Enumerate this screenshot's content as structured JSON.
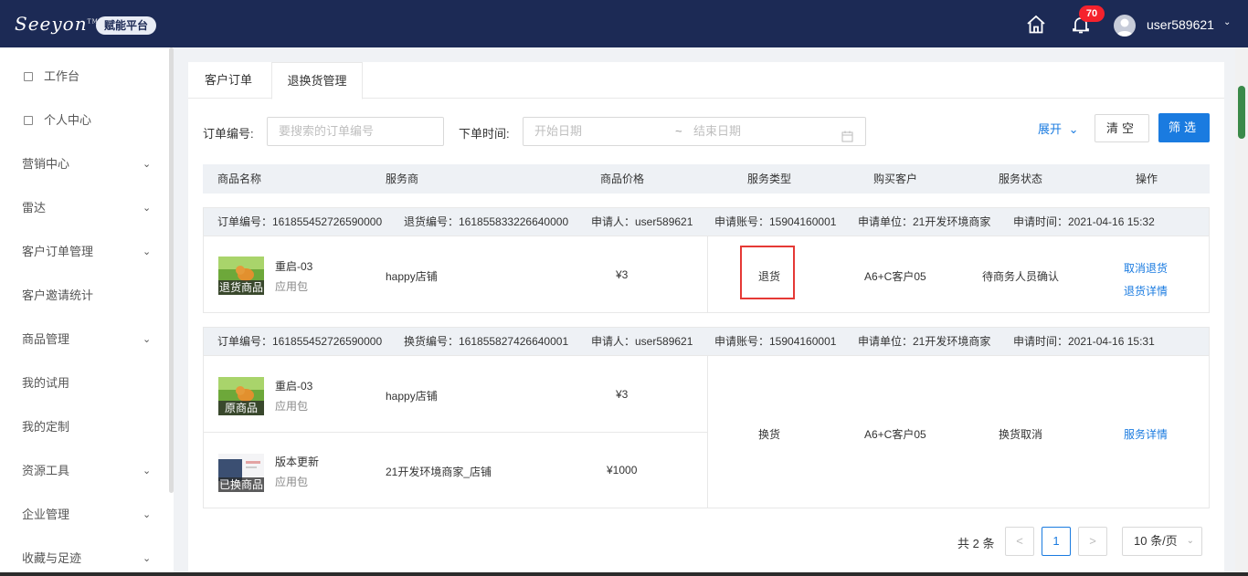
{
  "topbar": {
    "logo": "Seeyon",
    "logo_tm": "TM",
    "platform_badge": "赋能平台",
    "notification_count": "70",
    "username": "user589621",
    "bg_color": "#1c2a55"
  },
  "sidebar": {
    "items": [
      {
        "label": "工作台",
        "icon": "square-icon",
        "expandable": false
      },
      {
        "label": "个人中心",
        "icon": "square-icon",
        "expandable": false
      },
      {
        "label": "营销中心",
        "expandable": true
      },
      {
        "label": "雷达",
        "expandable": true
      },
      {
        "label": "客户订单管理",
        "expandable": true
      },
      {
        "label": "客户邀请统计",
        "expandable": false
      },
      {
        "label": "商品管理",
        "expandable": true
      },
      {
        "label": "我的试用",
        "expandable": false
      },
      {
        "label": "我的定制",
        "expandable": false
      },
      {
        "label": "资源工具",
        "expandable": true
      },
      {
        "label": "企业管理",
        "expandable": true
      },
      {
        "label": "收藏与足迹",
        "expandable": true
      }
    ]
  },
  "tabs": [
    {
      "label": "客户订单",
      "active": false
    },
    {
      "label": "退换货管理",
      "active": true
    }
  ],
  "filters": {
    "order_no_label": "订单编号:",
    "order_no_placeholder": "要搜索的订单编号",
    "order_time_label": "下单时间:",
    "start_placeholder": "开始日期",
    "range_sep": "~",
    "end_placeholder": "结束日期",
    "expand_label": "展开",
    "clear_label": "清空",
    "filter_label": "筛选"
  },
  "table": {
    "headers": [
      "商品名称",
      "服务商",
      "商品价格",
      "服务类型",
      "购买客户",
      "服务状态",
      "操作"
    ],
    "orders": [
      {
        "order_no": "订单编号：161855452726590000",
        "service_no": "退货编号：161855833226640000",
        "applicant": "申请人：user589621",
        "account": "申请账号：15904160001",
        "unit": "申请单位：21开发环境商家",
        "time": "申请时间：2021-04-16 15:32",
        "items": [
          {
            "thumb_label": "退货商品",
            "name": "重启-03",
            "type": "应用包",
            "provider": "happy店铺",
            "price": "¥3"
          }
        ],
        "service_type": "退货",
        "customer": "A6+C客户05",
        "status": "待商务人员确认",
        "actions": [
          "取消退货",
          "退货详情"
        ]
      },
      {
        "order_no": "订单编号：161855452726590000",
        "service_no": "换货编号：161855827426640001",
        "applicant": "申请人：user589621",
        "account": "申请账号：15904160001",
        "unit": "申请单位：21开发环境商家",
        "time": "申请时间：2021-04-16 15:31",
        "items": [
          {
            "thumb_label": "原商品",
            "name": "重启-03",
            "type": "应用包",
            "provider": "happy店铺",
            "price": "¥3"
          },
          {
            "thumb_label": "已换商品",
            "name": "版本更新",
            "type": "应用包",
            "provider": "21开发环境商家_店铺",
            "price": "¥1000"
          }
        ],
        "service_type": "换货",
        "customer": "A6+C客户05",
        "status": "换货取消",
        "actions": [
          "服务详情"
        ]
      }
    ]
  },
  "pagination": {
    "total": "共 2 条",
    "prev": "<",
    "current_page": "1",
    "next": ">",
    "page_size": "10 条/页"
  },
  "colors": {
    "accent": "#1a7be0",
    "highlight_border": "#e53935",
    "badge": "#f5222d"
  }
}
